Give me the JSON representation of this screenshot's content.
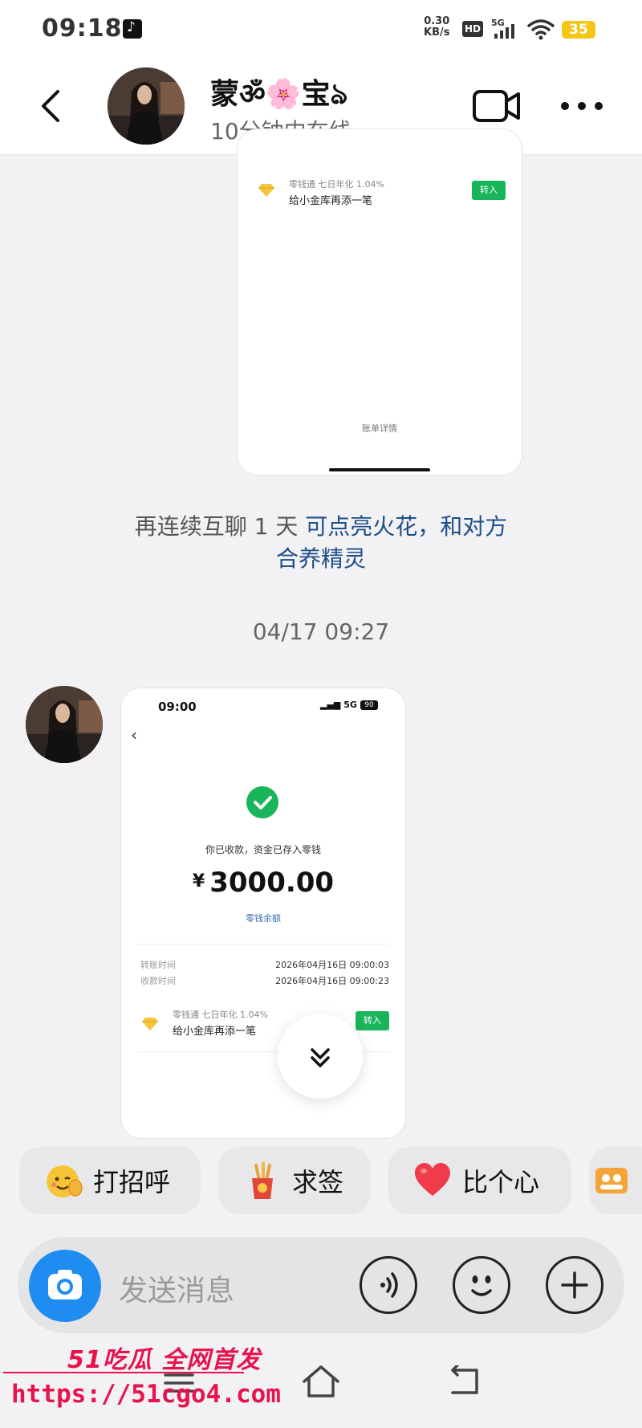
{
  "status_bar": {
    "time": "09:18",
    "net_speed_value": "0.30",
    "net_speed_unit": "KB/s",
    "hd": "HD",
    "network": "5G",
    "battery": "35",
    "battery_color": "#f5c518"
  },
  "header": {
    "contact_name": "蒙ॐ🌸宝ঌ",
    "online_status": "10分钟内在线"
  },
  "card1": {
    "product_line": "零钱通 七日年化 1.04%",
    "product_text": "给小金库再添一笔",
    "button_label": "转入",
    "detail_link": "账单详情"
  },
  "system_note": {
    "grey_text": "再连续互聊 1 天 ",
    "link_text_1": "可点亮火花，和对方",
    "link_text_2": "合养精灵"
  },
  "timestamp": "04/17 09:27",
  "card2": {
    "time": "09:00",
    "network": "5G",
    "battery": "90",
    "received_text": "你已收款，资金已存入零钱",
    "currency": "¥",
    "amount": "3000.00",
    "balance_link": "零钱余额",
    "rows": [
      {
        "label": "转账时间",
        "value": "2026年04月16日 09:00:03"
      },
      {
        "label": "收款时间",
        "value": "2026年04月16日 09:00:23"
      }
    ],
    "product_line": "零钱通 七日年化 1.04%",
    "product_text": "给小金库再添一笔",
    "button_label": "转入"
  },
  "quick_replies": [
    {
      "label": "打招呼",
      "icon": "wave-face-icon"
    },
    {
      "label": "求签",
      "icon": "fortune-sticks-icon"
    },
    {
      "label": "比个心",
      "icon": "heart-icon"
    }
  ],
  "input": {
    "placeholder": "发送消息"
  },
  "watermark": {
    "brand": "51吃瓜 全网首发",
    "url": "https://51cgo4.com"
  },
  "colors": {
    "accent_blue": "#1e8cf0",
    "link_blue": "#1d4e89",
    "wechat_green": "#18b55a",
    "watermark_red": "#e8124e"
  }
}
